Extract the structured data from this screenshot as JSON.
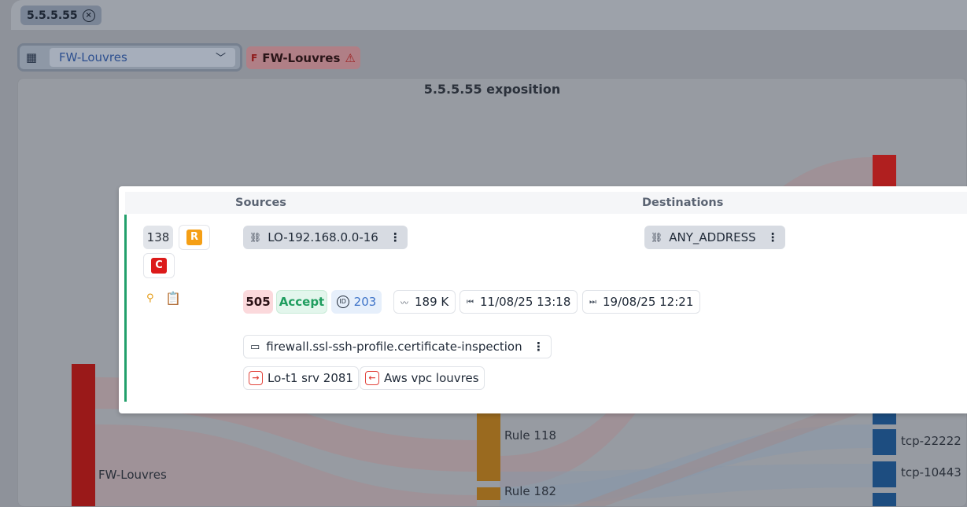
{
  "top_tag": {
    "label": "5.5.5.55"
  },
  "firewall_select": {
    "value": "FW-Louvres"
  },
  "firewall_badge": {
    "label": "FW-Louvres",
    "prefix": "F"
  },
  "chart": {
    "title": "5.5.5.55 exposition",
    "left_node": "FW-Louvres",
    "middle_nodes": [
      "Rule 118",
      "Rule 182"
    ],
    "right_nodes": [
      "tcp-22222",
      "tcp-10443"
    ]
  },
  "card": {
    "headers": {
      "sources": "Sources",
      "destinations": "Destinations"
    },
    "count": "138",
    "r_badge": "R",
    "c_badge": "C",
    "source_address": "LO-192.168.0.0-16",
    "destination_address": "ANY_ADDRESS",
    "policy_id": "505",
    "action": "Accept",
    "rule_id": "203",
    "hits": "189 K",
    "first_seen": "11/08/25 13:18",
    "last_seen": "19/08/25 12:21",
    "profile": "firewall.ssl-ssh-profile.certificate-inspection",
    "interfaces": [
      "Lo-t1 srv 2081",
      "Aws vpc louvres"
    ]
  },
  "colors": {
    "accent_green": "#22a06b",
    "danger_red": "#dc1a1a",
    "warning_orange": "#f59f15"
  }
}
